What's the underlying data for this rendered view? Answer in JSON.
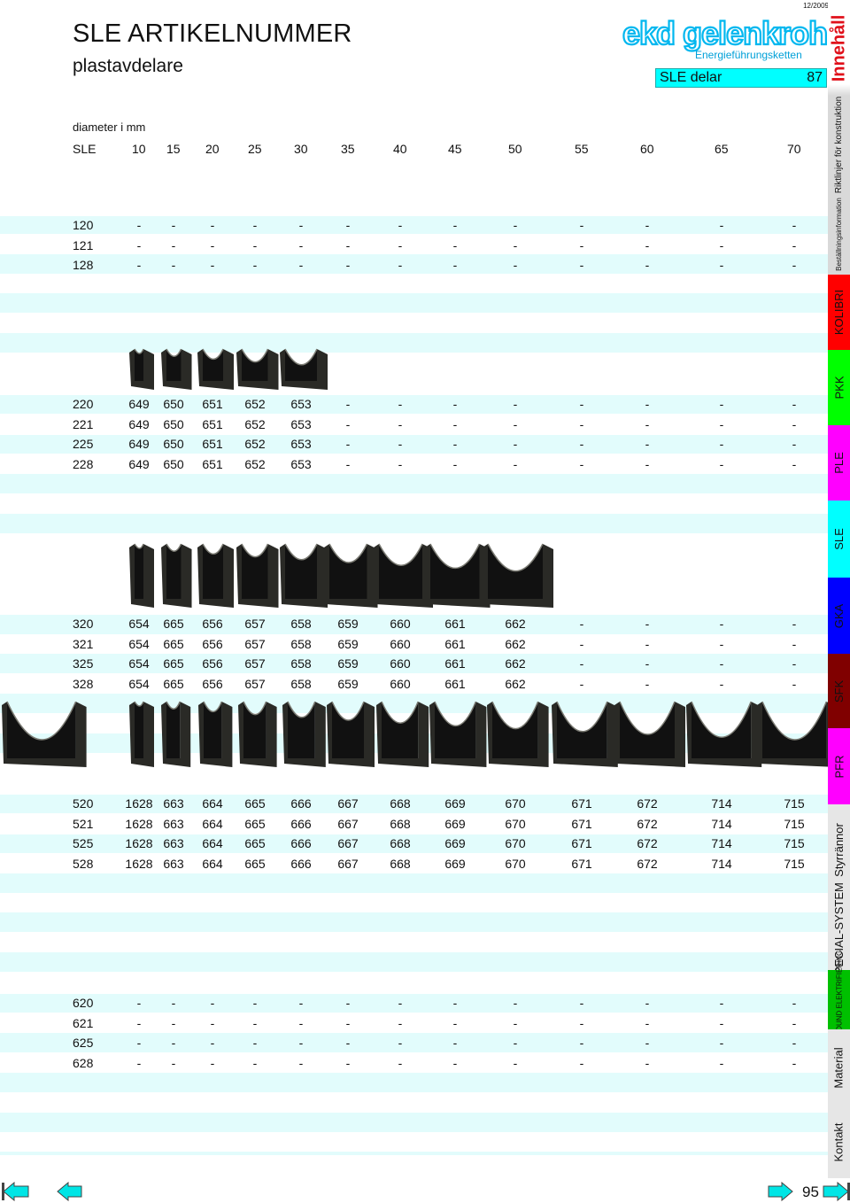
{
  "header": {
    "title": "SLE ARTIKELNUMMER",
    "subtitle": "plastavdelare",
    "date": "12/2009",
    "logo_text": "ekd gelenkrohr",
    "logo_tagline": "Energieführungsketten",
    "section_label": "SLE delar",
    "section_page": "87"
  },
  "table": {
    "caption": "diameter i mm",
    "columns": [
      "SLE",
      "10",
      "15",
      "20",
      "25",
      "30",
      "35",
      "40",
      "45",
      "50",
      "55",
      "60",
      "65",
      "70"
    ],
    "groups": [
      {
        "rows": [
          [
            "120",
            "-",
            "-",
            "-",
            "-",
            "-",
            "-",
            "-",
            "-",
            "-",
            "-",
            "-",
            "-",
            "-"
          ],
          [
            "121",
            "-",
            "-",
            "-",
            "-",
            "-",
            "-",
            "-",
            "-",
            "-",
            "-",
            "-",
            "-",
            "-"
          ],
          [
            "128",
            "-",
            "-",
            "-",
            "-",
            "-",
            "-",
            "-",
            "-",
            "-",
            "-",
            "-",
            "-",
            "-"
          ]
        ]
      },
      {
        "rows": [
          [
            "220",
            "649",
            "650",
            "651",
            "652",
            "653",
            "-",
            "-",
            "-",
            "-",
            "-",
            "-",
            "-",
            "-"
          ],
          [
            "221",
            "649",
            "650",
            "651",
            "652",
            "653",
            "-",
            "-",
            "-",
            "-",
            "-",
            "-",
            "-",
            "-"
          ],
          [
            "225",
            "649",
            "650",
            "651",
            "652",
            "653",
            "-",
            "-",
            "-",
            "-",
            "-",
            "-",
            "-",
            "-"
          ],
          [
            "228",
            "649",
            "650",
            "651",
            "652",
            "653",
            "-",
            "-",
            "-",
            "-",
            "-",
            "-",
            "-",
            "-"
          ]
        ]
      },
      {
        "rows": [
          [
            "320",
            "654",
            "665",
            "656",
            "657",
            "658",
            "659",
            "660",
            "661",
            "662",
            "-",
            "-",
            "-",
            "-"
          ],
          [
            "321",
            "654",
            "665",
            "656",
            "657",
            "658",
            "659",
            "660",
            "661",
            "662",
            "-",
            "-",
            "-",
            "-"
          ],
          [
            "325",
            "654",
            "665",
            "656",
            "657",
            "658",
            "659",
            "660",
            "661",
            "662",
            "-",
            "-",
            "-",
            "-"
          ],
          [
            "328",
            "654",
            "665",
            "656",
            "657",
            "658",
            "659",
            "660",
            "661",
            "662",
            "-",
            "-",
            "-",
            "-"
          ]
        ]
      },
      {
        "rows": [
          [
            "520",
            "1628",
            "663",
            "664",
            "665",
            "666",
            "667",
            "668",
            "669",
            "670",
            "671",
            "672",
            "714",
            "715"
          ],
          [
            "521",
            "1628",
            "663",
            "664",
            "665",
            "666",
            "667",
            "668",
            "669",
            "670",
            "671",
            "672",
            "714",
            "715"
          ],
          [
            "525",
            "1628",
            "663",
            "664",
            "665",
            "666",
            "667",
            "668",
            "669",
            "670",
            "671",
            "672",
            "714",
            "715"
          ],
          [
            "528",
            "1628",
            "663",
            "664",
            "665",
            "666",
            "667",
            "668",
            "669",
            "670",
            "671",
            "672",
            "714",
            "715"
          ]
        ]
      },
      {
        "rows": [
          [
            "620",
            "-",
            "-",
            "-",
            "-",
            "-",
            "-",
            "-",
            "-",
            "-",
            "-",
            "-",
            "-",
            "-"
          ],
          [
            "621",
            "-",
            "-",
            "-",
            "-",
            "-",
            "-",
            "-",
            "-",
            "-",
            "-",
            "-",
            "-",
            "-"
          ],
          [
            "625",
            "-",
            "-",
            "-",
            "-",
            "-",
            "-",
            "-",
            "-",
            "-",
            "-",
            "-",
            "-",
            "-"
          ],
          [
            "628",
            "-",
            "-",
            "-",
            "-",
            "-",
            "-",
            "-",
            "-",
            "-",
            "-",
            "-",
            "-",
            "-"
          ]
        ]
      }
    ]
  },
  "sidenav": [
    {
      "label": "Innehåll",
      "color": "#ffffff",
      "text": "#e0101a"
    },
    {
      "label": "Riktlinjer för konstruktion",
      "color": "#d9d9d9",
      "text": "#111111"
    },
    {
      "label": "Beställningsinformation",
      "color": "#d9d9d9",
      "text": "#111111"
    },
    {
      "label": "KOLIBRI",
      "color": "#ff0000",
      "text": "#111111"
    },
    {
      "label": "PKK",
      "color": "#00ff00",
      "text": "#111111"
    },
    {
      "label": "PLE",
      "color": "#ff00ff",
      "text": "#111111"
    },
    {
      "label": "SLE",
      "color": "#00ffff",
      "text": "#111111"
    },
    {
      "label": "GKA",
      "color": "#0000ff",
      "text": "#111111"
    },
    {
      "label": "SFK",
      "color": "#800000",
      "text": "#111111"
    },
    {
      "label": "PFR",
      "color": "#ff00ff",
      "text": "#111111"
    },
    {
      "label": "Styrrännor",
      "color": "#e6e6e6",
      "text": "#111111"
    },
    {
      "label": "SPECIAL-SYSTEM",
      "color": "#e6e6e6",
      "text": "#111111"
    },
    {
      "label": "ALLROUND ELEKTRIFIERING",
      "color": "#00c000",
      "text": "#111111"
    },
    {
      "label": "Material",
      "color": "#e6e6e6",
      "text": "#111111"
    },
    {
      "label": "Kontakt",
      "color": "#e6e6e6",
      "text": "#111111"
    }
  ],
  "footer": {
    "page_number": "95"
  },
  "colors": {
    "band": "#e2fcfc",
    "accent": "#00ffff",
    "logo": "#00b7ef"
  },
  "icons": [
    "first-page-icon",
    "prev-page-icon",
    "next-page-icon",
    "last-page-icon"
  ]
}
